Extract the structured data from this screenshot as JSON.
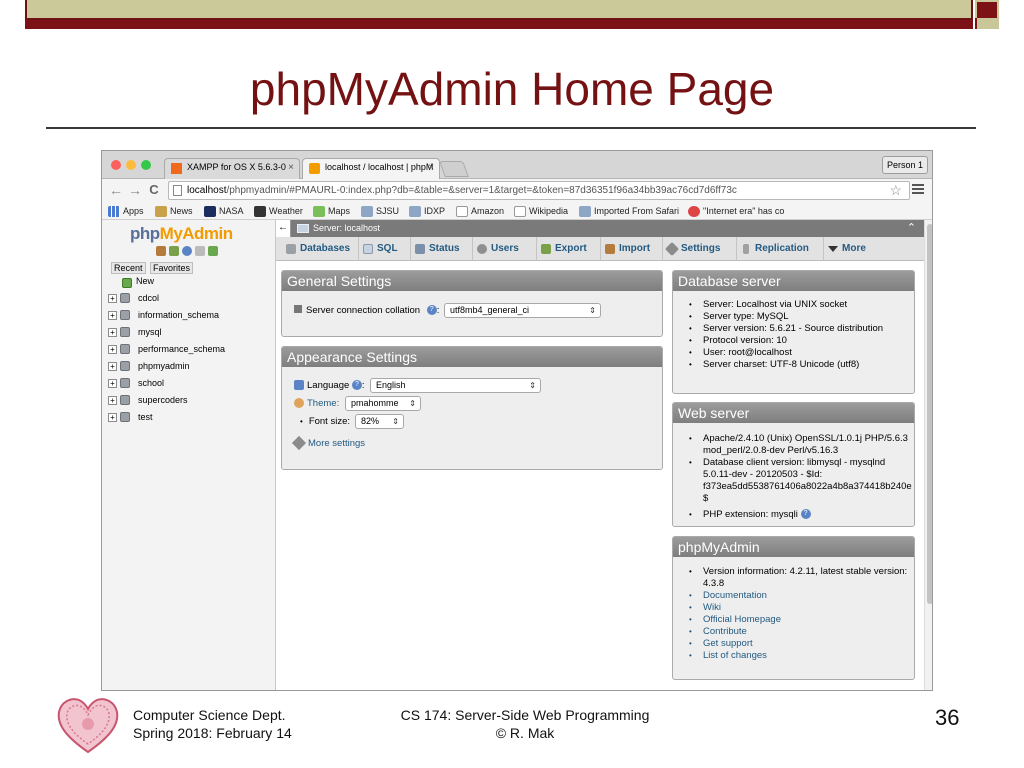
{
  "slide": {
    "title": "phpMyAdmin Home Page",
    "footer_left_line1": "Computer Science Dept.",
    "footer_left_line2": "Spring 2018: February 14",
    "footer_center_line1": "CS 174: Server-Side Web Programming",
    "footer_center_line2": "© R. Mak",
    "page_number": "36",
    "accent_color": "#741112"
  },
  "browser": {
    "tabs": [
      {
        "label": "XAMPP for OS X 5.6.3-0",
        "close": "×"
      },
      {
        "label": "localhost / localhost | phpM",
        "close": "×"
      }
    ],
    "person_button": "Person 1",
    "url_host": "localhost",
    "url_rest": "/phpmyadmin/#PMAURL-0:index.php?db=&table=&server=1&target=&token=87d36351f96a34bb39ac76cd7d6ff73c",
    "back": "←",
    "forward": "→",
    "reload": "C",
    "star": "☆",
    "bookmarks": [
      "Apps",
      "News",
      "NASA",
      "Weather",
      "Maps",
      "SJSU",
      "IDXP",
      "Amazon",
      "Wikipedia",
      "Imported From Safari",
      "\"Internet era\" has co"
    ]
  },
  "pma": {
    "logo_part1": "php",
    "logo_part2": "MyAdmin",
    "left_tabs": [
      "Recent",
      "Favorites"
    ],
    "tree_new": "New",
    "databases": [
      "cdcol",
      "information_schema",
      "mysql",
      "performance_schema",
      "phpmyadmin",
      "school",
      "supercoders",
      "test"
    ],
    "collapse": "←",
    "server_label": "Server: localhost",
    "server_up": "⌃",
    "menu": [
      "Databases",
      "SQL",
      "Status",
      "Users",
      "Export",
      "Import",
      "Settings",
      "Replication",
      "More"
    ],
    "general_settings": {
      "title": "General Settings",
      "collation_label": "Server connection collation",
      "collation_value": "utf8mb4_general_ci"
    },
    "appearance_settings": {
      "title": "Appearance Settings",
      "language_label": "Language",
      "language_value": "English",
      "theme_label": "Theme:",
      "theme_value": "pmahomme",
      "font_label": "Font size:",
      "font_value": "82%",
      "more_settings": "More settings"
    },
    "database_server": {
      "title": "Database server",
      "items": [
        "Server: Localhost via UNIX socket",
        "Server type: MySQL",
        "Server version: 5.6.21 - Source distribution",
        "Protocol version: 10",
        "User: root@localhost",
        "Server charset: UTF-8 Unicode (utf8)"
      ]
    },
    "web_server": {
      "title": "Web server",
      "item1_line1": "Apache/2.4.10 (Unix) OpenSSL/1.0.1j PHP/5.6.3",
      "item1_line2": "mod_perl/2.0.8-dev Perl/v5.16.3",
      "item2_line1": "Database client version: libmysql - mysqlnd",
      "item2_line2": "5.0.11-dev - 20120503 - $Id:",
      "item2_line3": "f373ea5dd5538761406a8022a4b8a374418b240e",
      "item2_line4": "$",
      "item3": "PHP extension: mysqli"
    },
    "phpmyadmin_box": {
      "title": "phpMyAdmin",
      "version_line1": "Version information: 4.2.11, latest stable version:",
      "version_line2": "4.3.8",
      "links": [
        "Documentation",
        "Wiki",
        "Official Homepage",
        "Contribute",
        "Get support",
        "List of changes"
      ]
    }
  }
}
